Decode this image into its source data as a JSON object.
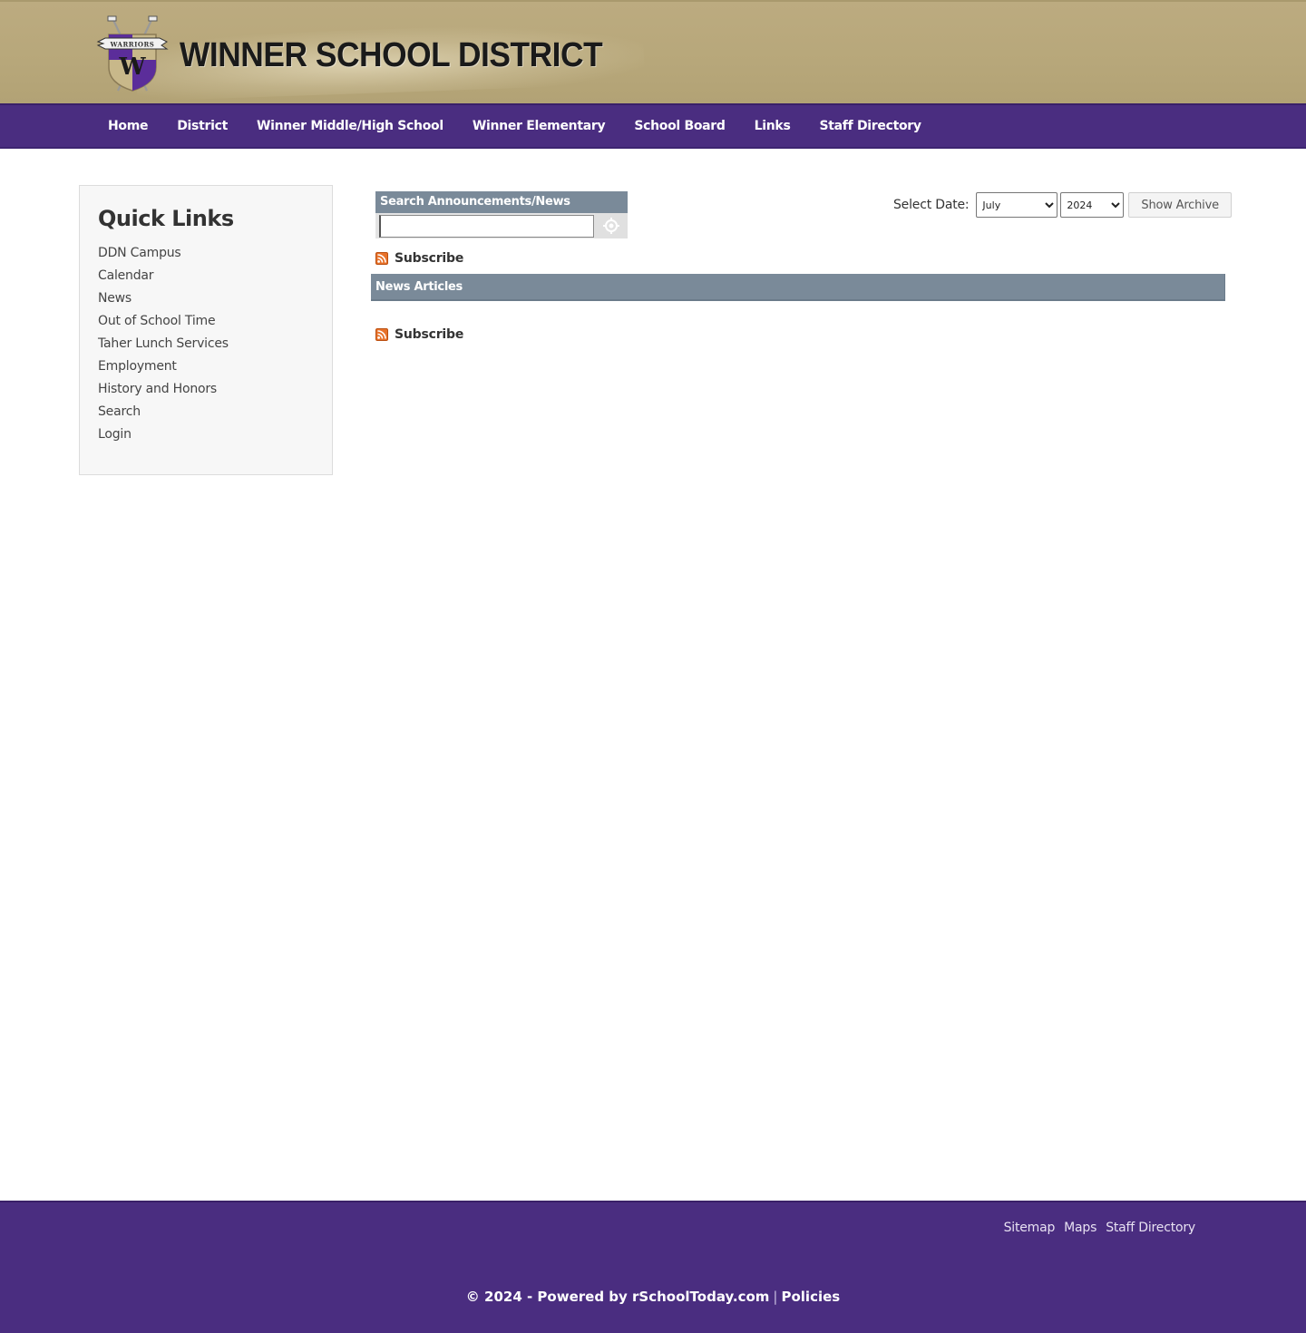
{
  "header": {
    "site_title": "WINNER SCHOOL DISTRICT",
    "logo_banner_text": "WARRIORS",
    "logo_letter": "W",
    "colors": {
      "primary_purple": "#4a2d80",
      "gold": "#b7a77a",
      "section_gray": "#7a8a99"
    }
  },
  "nav": {
    "items": [
      {
        "label": "Home"
      },
      {
        "label": "District"
      },
      {
        "label": "Winner Middle/High School"
      },
      {
        "label": "Winner Elementary"
      },
      {
        "label": "School Board"
      },
      {
        "label": "Links"
      },
      {
        "label": "Staff Directory"
      }
    ]
  },
  "sidebar": {
    "title": "Quick Links",
    "items": [
      {
        "label": "DDN Campus"
      },
      {
        "label": "Calendar"
      },
      {
        "label": "News"
      },
      {
        "label": "Out of School Time"
      },
      {
        "label": "Taher Lunch Services"
      },
      {
        "label": "Employment"
      },
      {
        "label": "History and Honors"
      },
      {
        "label": "Search"
      },
      {
        "label": "Login"
      }
    ]
  },
  "search": {
    "title": "Search Announcements/News",
    "value": "",
    "placeholder": "",
    "button_icon": "target-icon"
  },
  "archive": {
    "label": "Select Date:",
    "month_selected": "July",
    "year_selected": "2024",
    "button_label": "Show Archive"
  },
  "subscribe": {
    "top_label": "Subscribe",
    "bottom_label": "Subscribe",
    "icon": "rss-icon"
  },
  "news": {
    "header": "News Articles",
    "articles": []
  },
  "footer": {
    "links": [
      {
        "label": "Sitemap"
      },
      {
        "label": "Maps"
      },
      {
        "label": "Staff Directory"
      }
    ],
    "copyright": "© 2024 - Powered by rSchoolToday.com",
    "separator": "|",
    "policies_label": "Policies"
  }
}
